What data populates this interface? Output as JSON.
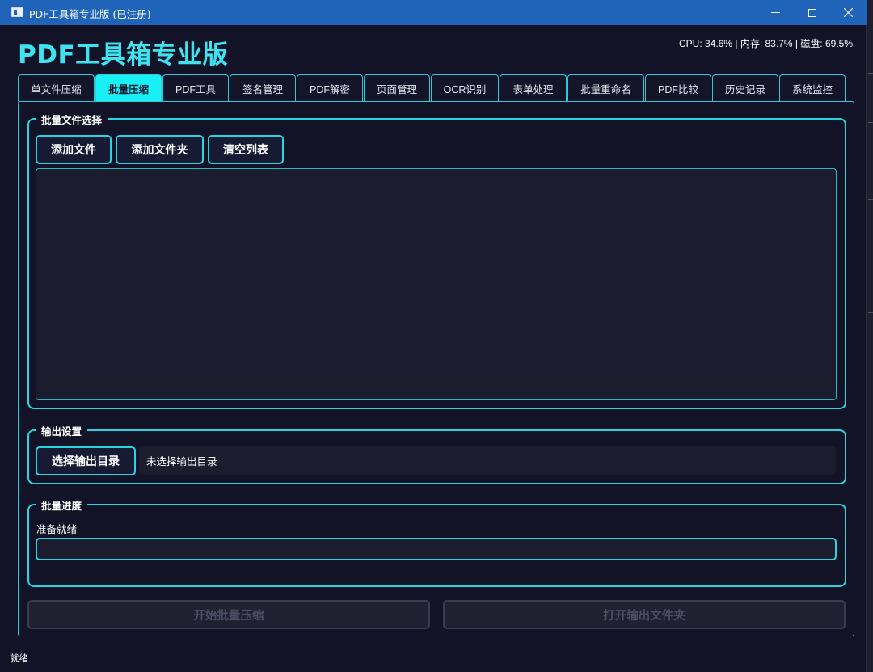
{
  "window": {
    "title": "PDF工具箱专业版 (已注册)"
  },
  "header": {
    "app_title": "PDF工具箱专业版",
    "stats": "CPU: 34.6% | 内存: 83.7% | 磁盘: 69.5%"
  },
  "tabs": [
    {
      "label": "单文件压缩",
      "active": false
    },
    {
      "label": "批量压缩",
      "active": true
    },
    {
      "label": "PDF工具",
      "active": false
    },
    {
      "label": "签名管理",
      "active": false
    },
    {
      "label": "PDF解密",
      "active": false
    },
    {
      "label": "页面管理",
      "active": false
    },
    {
      "label": "OCR识别",
      "active": false
    },
    {
      "label": "表单处理",
      "active": false
    },
    {
      "label": "批量重命名",
      "active": false
    },
    {
      "label": "PDF比较",
      "active": false
    },
    {
      "label": "历史记录",
      "active": false
    },
    {
      "label": "系统监控",
      "active": false
    }
  ],
  "file_select": {
    "title": "批量文件选择",
    "add_file": "添加文件",
    "add_folder": "添加文件夹",
    "clear_list": "清空列表"
  },
  "output": {
    "title": "输出设置",
    "choose_dir": "选择输出目录",
    "path_text": "未选择输出目录"
  },
  "progress": {
    "title": "批量进度",
    "status": "准备就绪",
    "value": 0
  },
  "actions": {
    "start": "开始批量压缩",
    "open_folder": "打开输出文件夹"
  },
  "statusbar": {
    "text": "就绪"
  },
  "colors": {
    "accent": "#18f0f5",
    "titlebar": "#1f64b8",
    "background": "#121326"
  }
}
